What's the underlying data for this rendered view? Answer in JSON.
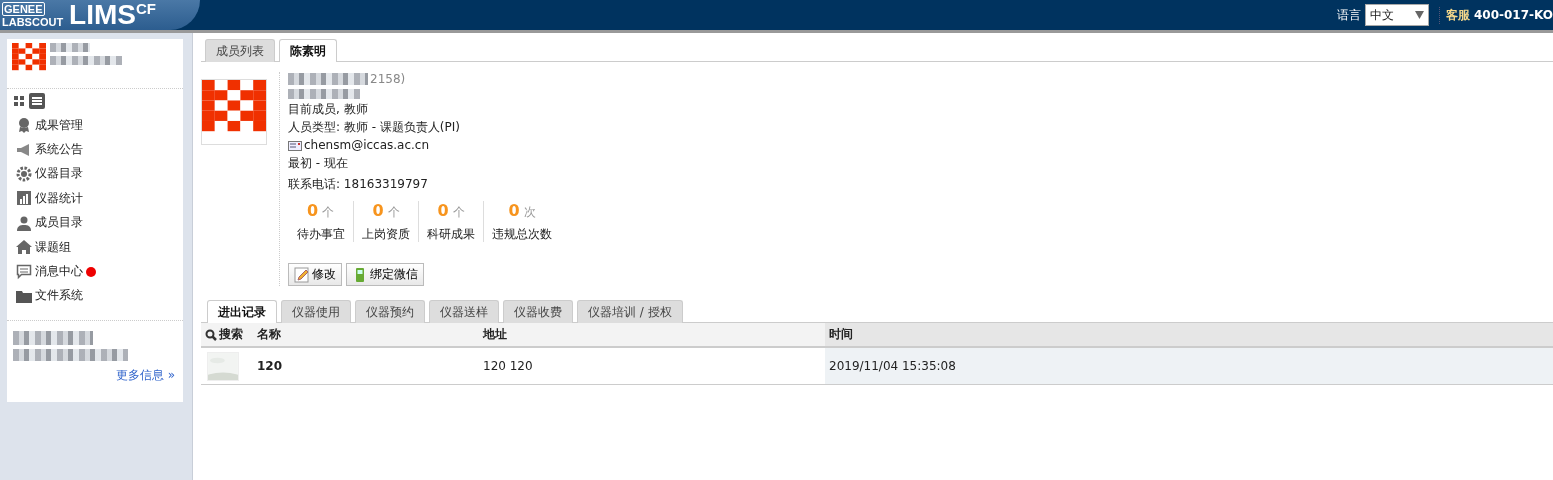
{
  "header": {
    "logo_top": "GENEE",
    "logo_bottom": "LABSCOUT",
    "logo_main": "LIMS",
    "logo_sup": "CF",
    "language_label": "语言",
    "language_value": "中文",
    "service": "客服 400-017-KO"
  },
  "sidebar": {
    "view_modes": [
      {
        "kind": "grid",
        "selected": false
      },
      {
        "kind": "list",
        "selected": true
      }
    ],
    "items": [
      {
        "label": "成果管理",
        "kind": "award",
        "badge": false
      },
      {
        "label": "系统公告",
        "kind": "megaphone",
        "badge": false
      },
      {
        "label": "仪器目录",
        "kind": "gear",
        "badge": false
      },
      {
        "label": "仪器统计",
        "kind": "chart",
        "badge": false
      },
      {
        "label": "成员目录",
        "kind": "person",
        "badge": false
      },
      {
        "label": "课题组",
        "kind": "house",
        "badge": false
      },
      {
        "label": "消息中心",
        "kind": "chat",
        "badge": true
      },
      {
        "label": "文件系统",
        "kind": "folder",
        "badge": false
      }
    ],
    "more": "更多信息 »"
  },
  "top_tabs": [
    {
      "label": "成员列表",
      "selected": false
    },
    {
      "label": "陈素明",
      "selected": true
    }
  ],
  "profile": {
    "name_tail": "2158)",
    "status": "目前成员, 教师",
    "type": "人员类型: 教师 - 课题负责人(PI)",
    "email": "chensm@iccas.ac.cn",
    "period": "最初 - 现在",
    "phone": "联系电话: 18163319797",
    "stats": [
      {
        "value": "0",
        "unit": "个",
        "label": "待办事宜"
      },
      {
        "value": "0",
        "unit": "个",
        "label": "上岗资质"
      },
      {
        "value": "0",
        "unit": "个",
        "label": "科研成果"
      },
      {
        "value": "0",
        "unit": "次",
        "label": "违规总次数"
      }
    ],
    "buttons": [
      {
        "label": "修改",
        "kind": "edit"
      },
      {
        "label": "绑定微信",
        "kind": "wechat"
      }
    ]
  },
  "record_tabs": [
    {
      "label": "进出记录",
      "selected": true
    },
    {
      "label": "仪器使用",
      "selected": false
    },
    {
      "label": "仪器预约",
      "selected": false
    },
    {
      "label": "仪器送样",
      "selected": false
    },
    {
      "label": "仪器收费",
      "selected": false
    },
    {
      "label": "仪器培训 / 授权",
      "selected": false
    }
  ],
  "table": {
    "search": "搜索",
    "columns": [
      "名称",
      "地址",
      "时间"
    ],
    "rows": [
      {
        "name": "120",
        "address": "120 120",
        "time": "2019/11/04 15:35:08"
      }
    ]
  }
}
